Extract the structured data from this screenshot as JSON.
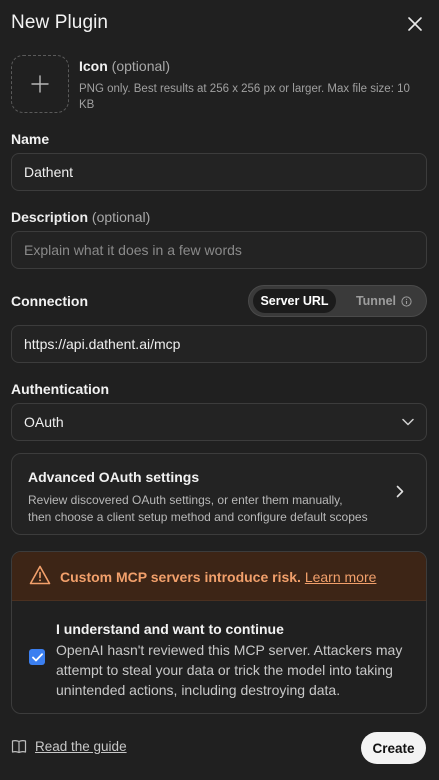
{
  "header": {
    "title": "New Plugin"
  },
  "icon_upload": {
    "label": "Icon",
    "optional": "(optional)",
    "help": "PNG only. Best results at 256 x 256 px or larger. Max file size: 10 KB"
  },
  "name": {
    "label": "Name",
    "value": "Dathent"
  },
  "description": {
    "label": "Description",
    "optional": "(optional)",
    "placeholder": "Explain what it does in a few words"
  },
  "connection": {
    "label": "Connection",
    "options": [
      "Server URL",
      "Tunnel"
    ],
    "selected": "Server URL",
    "value": "https://api.dathent.ai/mcp"
  },
  "authentication": {
    "label": "Authentication",
    "selected": "OAuth"
  },
  "advanced": {
    "title": "Advanced OAuth settings",
    "description": "Review discovered OAuth settings, or enter them manually, then choose a client setup method and configure default scopes"
  },
  "risk": {
    "warning": "Custom MCP servers introduce risk.",
    "link": "Learn more",
    "ack_title": "I understand and want to continue",
    "ack_desc": "OpenAI hasn't reviewed this MCP server. Attackers may attempt to steal your data or trick the model into taking unintended actions, including destroying data.",
    "checked": true
  },
  "footer": {
    "guide": "Read the guide",
    "create": "Create"
  },
  "colors": {
    "background": "#202020",
    "warning": "#f2a06b",
    "checkbox": "#3b7ff0"
  }
}
